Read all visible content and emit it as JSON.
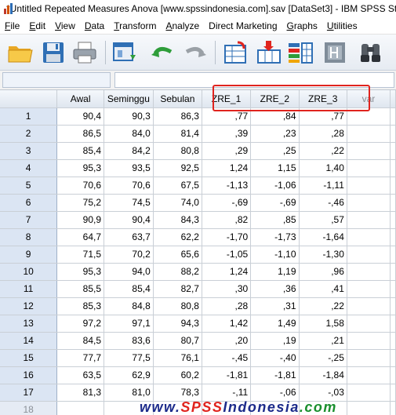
{
  "window": {
    "title": "*Untitled Repeated Measures Anova [www.spssindonesia.com].sav [DataSet3] - IBM SPSS St"
  },
  "menu": [
    {
      "label": "File",
      "u": "F",
      "rest": "ile"
    },
    {
      "label": "Edit",
      "u": "E",
      "rest": "dit"
    },
    {
      "label": "View",
      "u": "V",
      "rest": "iew"
    },
    {
      "label": "Data",
      "u": "D",
      "rest": "ata"
    },
    {
      "label": "Transform",
      "u": "T",
      "rest": "ransform"
    },
    {
      "label": "Analyze",
      "u": "A",
      "rest": "nalyze"
    },
    {
      "label": "Direct Marketing",
      "u": "",
      "rest": "Direct Marketing"
    },
    {
      "label": "Graphs",
      "u": "G",
      "rest": "raphs"
    },
    {
      "label": "Utilities",
      "u": "U",
      "rest": "tilities"
    }
  ],
  "toolbar": {
    "icons": [
      "open-folder-icon",
      "save-icon",
      "print-icon",
      "dialog-recall-icon",
      "undo-icon",
      "redo-icon",
      "goto-case-icon",
      "goto-variable-icon",
      "variables-icon",
      "run-descriptives-icon",
      "find-icon"
    ]
  },
  "cell_editor": {
    "reference": "",
    "value": ""
  },
  "grid": {
    "columns": [
      "Awal",
      "Seminggu",
      "Sebulan",
      "ZRE_1",
      "ZRE_2",
      "ZRE_3",
      "var"
    ],
    "rows": [
      {
        "n": "1",
        "v": [
          "90,4",
          "90,3",
          "86,3",
          ",77",
          ",84",
          ",77"
        ]
      },
      {
        "n": "2",
        "v": [
          "86,5",
          "84,0",
          "81,4",
          ",39",
          ",23",
          ",28"
        ]
      },
      {
        "n": "3",
        "v": [
          "85,4",
          "84,2",
          "80,8",
          ",29",
          ",25",
          ",22"
        ]
      },
      {
        "n": "4",
        "v": [
          "95,3",
          "93,5",
          "92,5",
          "1,24",
          "1,15",
          "1,40"
        ]
      },
      {
        "n": "5",
        "v": [
          "70,6",
          "70,6",
          "67,5",
          "-1,13",
          "-1,06",
          "-1,11"
        ]
      },
      {
        "n": "6",
        "v": [
          "75,2",
          "74,5",
          "74,0",
          "-,69",
          "-,69",
          "-,46"
        ]
      },
      {
        "n": "7",
        "v": [
          "90,9",
          "90,4",
          "84,3",
          ",82",
          ",85",
          ",57"
        ]
      },
      {
        "n": "8",
        "v": [
          "64,7",
          "63,7",
          "62,2",
          "-1,70",
          "-1,73",
          "-1,64"
        ]
      },
      {
        "n": "9",
        "v": [
          "71,5",
          "70,2",
          "65,6",
          "-1,05",
          "-1,10",
          "-1,30"
        ]
      },
      {
        "n": "10",
        "v": [
          "95,3",
          "94,0",
          "88,2",
          "1,24",
          "1,19",
          ",96"
        ]
      },
      {
        "n": "11",
        "v": [
          "85,5",
          "85,4",
          "82,7",
          ",30",
          ",36",
          ",41"
        ]
      },
      {
        "n": "12",
        "v": [
          "85,3",
          "84,8",
          "80,8",
          ",28",
          ",31",
          ",22"
        ]
      },
      {
        "n": "13",
        "v": [
          "97,2",
          "97,1",
          "94,3",
          "1,42",
          "1,49",
          "1,58"
        ]
      },
      {
        "n": "14",
        "v": [
          "84,5",
          "83,6",
          "80,7",
          ",20",
          ",19",
          ",21"
        ]
      },
      {
        "n": "15",
        "v": [
          "77,7",
          "77,5",
          "76,1",
          "-,45",
          "-,40",
          "-,25"
        ]
      },
      {
        "n": "16",
        "v": [
          "63,5",
          "62,9",
          "60,2",
          "-1,81",
          "-1,81",
          "-1,84"
        ]
      },
      {
        "n": "17",
        "v": [
          "81,3",
          "81,0",
          "78,3",
          "-,11",
          "-,06",
          "-,03"
        ]
      },
      {
        "n": "18",
        "v": [
          "",
          "",
          "",
          "",
          "",
          ""
        ]
      }
    ]
  },
  "watermark": {
    "www": "www.",
    "spss": "SPSS",
    "indonesia": "Indonesia",
    "com": ".com"
  },
  "colors": {
    "highlight": "#e0241e",
    "row_header_bg": "#dbe5f3"
  }
}
